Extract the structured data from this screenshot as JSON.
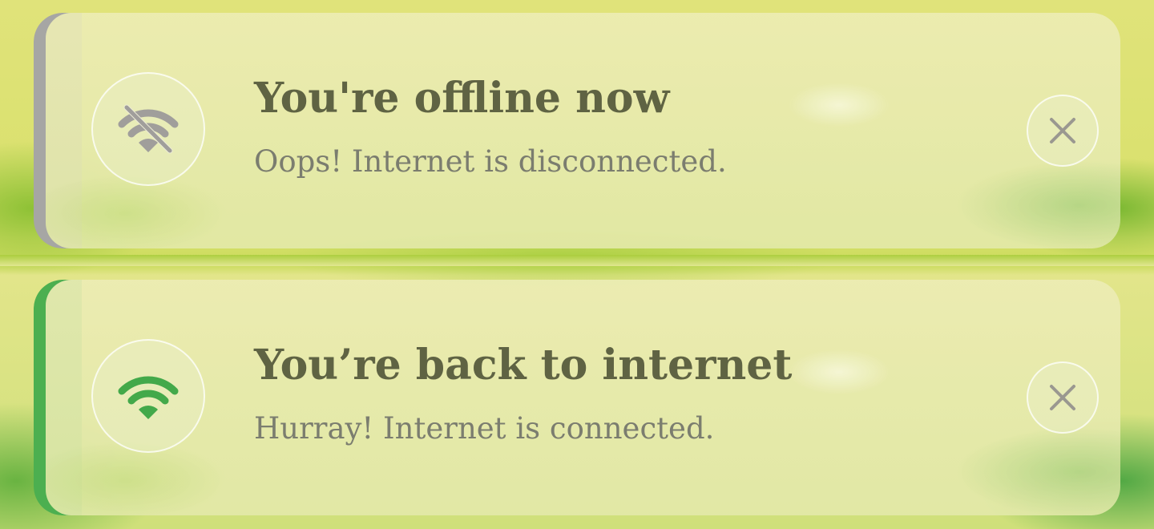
{
  "notifications": [
    {
      "state": "offline",
      "title": "You're offline now",
      "message": "Oops! Internet is disconnected.",
      "icon": "wifi-off-icon",
      "accent_color": "#a6a6a4",
      "icon_color": "#a09e9b"
    },
    {
      "state": "online",
      "title": "You’re back to internet",
      "message": "Hurray! Internet is connected.",
      "icon": "wifi-icon",
      "accent_color": "#4caf50",
      "icon_color": "#43a94a"
    }
  ],
  "colors": {
    "title_text": "#5f6343",
    "message_text": "#7b7d6f",
    "close_icon": "#9a9890"
  },
  "close_icon": "close-icon"
}
